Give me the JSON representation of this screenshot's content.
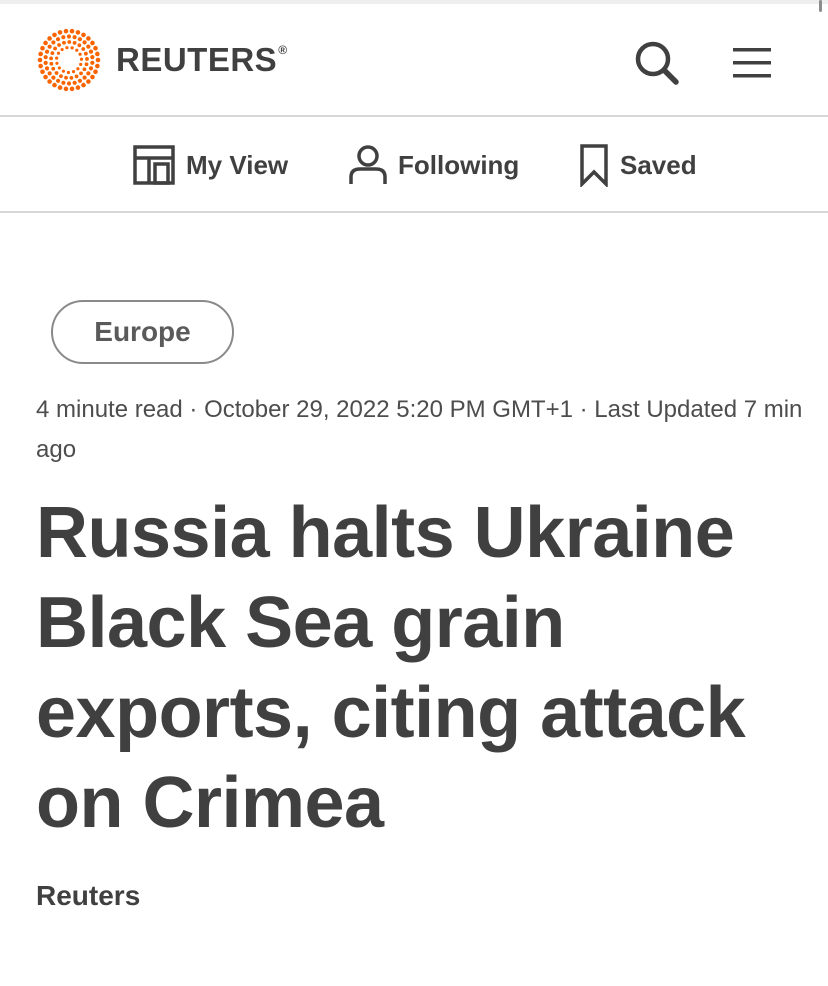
{
  "header": {
    "brand": "REUTERS",
    "brand_mark": "®",
    "brand_color": "#fa6400",
    "icons": {
      "search": "search-icon",
      "menu": "hamburger-menu-icon"
    }
  },
  "subnav": {
    "items": [
      {
        "label": "My View",
        "icon": "layout-icon"
      },
      {
        "label": "Following",
        "icon": "person-icon"
      },
      {
        "label": "Saved",
        "icon": "bookmark-icon"
      }
    ]
  },
  "article": {
    "section": "Europe",
    "read_time": "4 minute read",
    "separator": " · ",
    "published": "October 29, 2022 5:20 PM GMT+1",
    "updated": "Last Updated 7 min ago",
    "headline": "Russia halts Ukraine Black Sea grain exports, citing attack on Crimea",
    "byline": "Reuters"
  },
  "colors": {
    "text": "#404040",
    "divider": "#d6d6d6",
    "tag_border": "#8a8a8a"
  }
}
